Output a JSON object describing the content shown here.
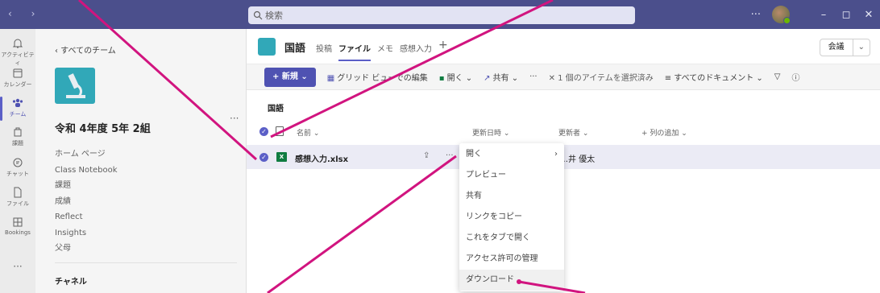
{
  "titlebar": {
    "nav": "‹ ›",
    "search_placeholder": "検索",
    "more": "···",
    "minimize": "–",
    "maximize": "◻",
    "close": "✕"
  },
  "rail": [
    {
      "label": "アクティビティ",
      "icon": "bell-icon"
    },
    {
      "label": "カレンダー",
      "icon": "calendar-icon"
    },
    {
      "label": "チーム",
      "icon": "teams-icon"
    },
    {
      "label": "課題",
      "icon": "assignments-icon"
    },
    {
      "label": "チャット",
      "icon": "chat-icon"
    },
    {
      "label": "ファイル",
      "icon": "file-icon"
    },
    {
      "label": "Bookings",
      "icon": "bookings-icon"
    },
    {
      "label": "···",
      "icon": "more-icon"
    }
  ],
  "team": {
    "back": "‹  すべてのチーム",
    "name": "令和 4年度 5年 2組",
    "dots": "···",
    "links": [
      "ホーム ページ",
      "Class Notebook",
      "課題",
      "成績",
      "Reflect",
      "Insights",
      "父母"
    ],
    "channels": "チャネル"
  },
  "header": {
    "title": "国語",
    "tabs": [
      "投稿",
      "ファイル",
      "メモ",
      "感想入力"
    ],
    "plus": "+",
    "meet": "会議",
    "meet_icon": "video-icon",
    "chev": "⌄"
  },
  "toolbar": {
    "new": "+ 新規  ⌄",
    "grid": "グリッド ビューでの編集",
    "open": "開く ⌄",
    "share": "共有 ⌄",
    "more": "···",
    "selected": "✕ 1 個のアイテムを選択済み",
    "alldocs": "≡ すべてのドキュメント ⌄",
    "filter": "▽",
    "info": "ⓘ"
  },
  "breadcrumb": "国語",
  "columns": {
    "name": "名前 ⌄",
    "modified": "更新日時 ⌄",
    "modified_by": "更新者 ⌄",
    "add": "+ 列の追加 ⌄"
  },
  "file": {
    "name": "感想入力.xlsx",
    "ext_badge": "X",
    "modified_by": "…井 優太"
  },
  "menu": {
    "items": [
      "開く",
      "プレビュー",
      "共有",
      "リンクをコピー",
      "これをタブで開く",
      "アクセス許可の管理",
      "ダウンロード"
    ],
    "chevron": "›"
  },
  "colors": {
    "accent": "#5b5fc7",
    "titlebar": "#4b4f8c",
    "annotation": "#d1147f",
    "excel": "#107c41"
  }
}
